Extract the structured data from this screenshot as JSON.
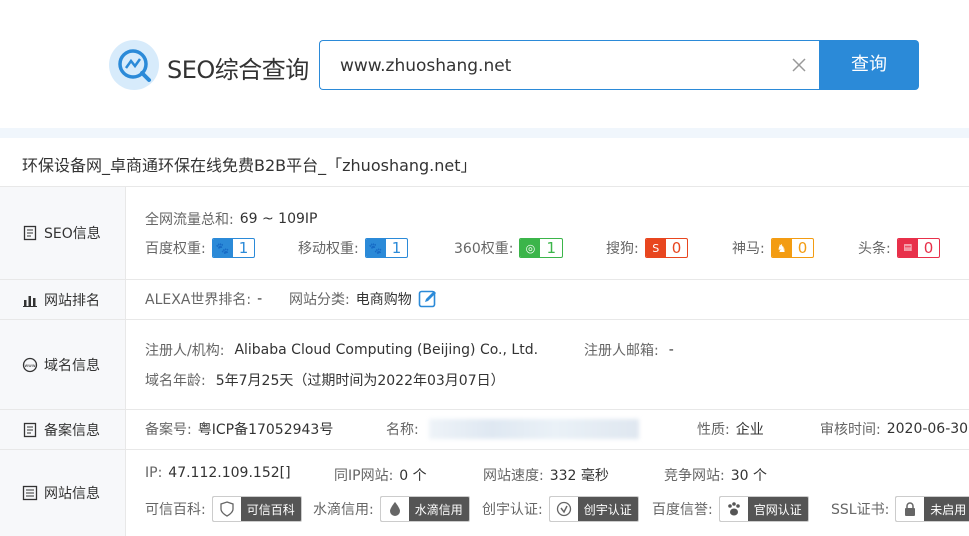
{
  "header": {
    "logo_text": "SEO综合查询",
    "search_value": "www.zhuoshang.net",
    "search_button": "查询"
  },
  "page_title": "环保设备网_卓商通环保在线免费B2B平台_「zhuoshang.net」",
  "seo": {
    "label": "SEO信息",
    "traffic_label": "全网流量总和:",
    "traffic_value": "69 ~ 109IP",
    "weights": [
      {
        "label": "百度权重:",
        "value": "1",
        "color": "#2b8ad8"
      },
      {
        "label": "移动权重:",
        "value": "1",
        "color": "#2b8ad8"
      },
      {
        "label": "360权重:",
        "value": "1",
        "color": "#3bb54a"
      },
      {
        "label": "搜狗:",
        "value": "0",
        "color": "#e8461f"
      },
      {
        "label": "神马:",
        "value": "0",
        "color": "#f39c12"
      },
      {
        "label": "头条:",
        "value": "0",
        "color": "#e8304a"
      }
    ]
  },
  "rank": {
    "label": "网站排名",
    "alexa_label": "ALEXA世界排名:",
    "alexa_value": "-",
    "category_label": "网站分类:",
    "category_value": "电商购物"
  },
  "domain": {
    "label": "域名信息",
    "registrant_label": "注册人/机构:",
    "registrant_value": "Alibaba Cloud Computing (Beijing) Co., Ltd.",
    "email_label": "注册人邮箱:",
    "email_value": "-",
    "age_label": "域名年龄:",
    "age_value": "5年7月25天（过期时间为2022年03月07日）"
  },
  "icp": {
    "label": "备案信息",
    "number_label": "备案号:",
    "number_value": "粤ICP备17052943号",
    "name_label": "名称:",
    "nature_label": "性质:",
    "nature_value": "企业",
    "audit_label": "审核时间:",
    "audit_value": "2020-06-30"
  },
  "site": {
    "label": "网站信息",
    "ip_label": "IP:",
    "ip_value": "47.112.109.152[]",
    "sameip_label": "同IP网站:",
    "sameip_value": "0 个",
    "speed_label": "网站速度:",
    "speed_value": "332 毫秒",
    "compete_label": "竞争网站:",
    "compete_value": "30 个",
    "certs": [
      {
        "label": "可信百科:",
        "badge": "可信百科"
      },
      {
        "label": "水滴信用:",
        "badge": "水滴信用"
      },
      {
        "label": "创宇认证:",
        "badge": "创宇认证"
      },
      {
        "label": "百度信誉:",
        "badge": "官网认证"
      },
      {
        "label": "SSL证书:",
        "badge": "未启用"
      }
    ]
  }
}
